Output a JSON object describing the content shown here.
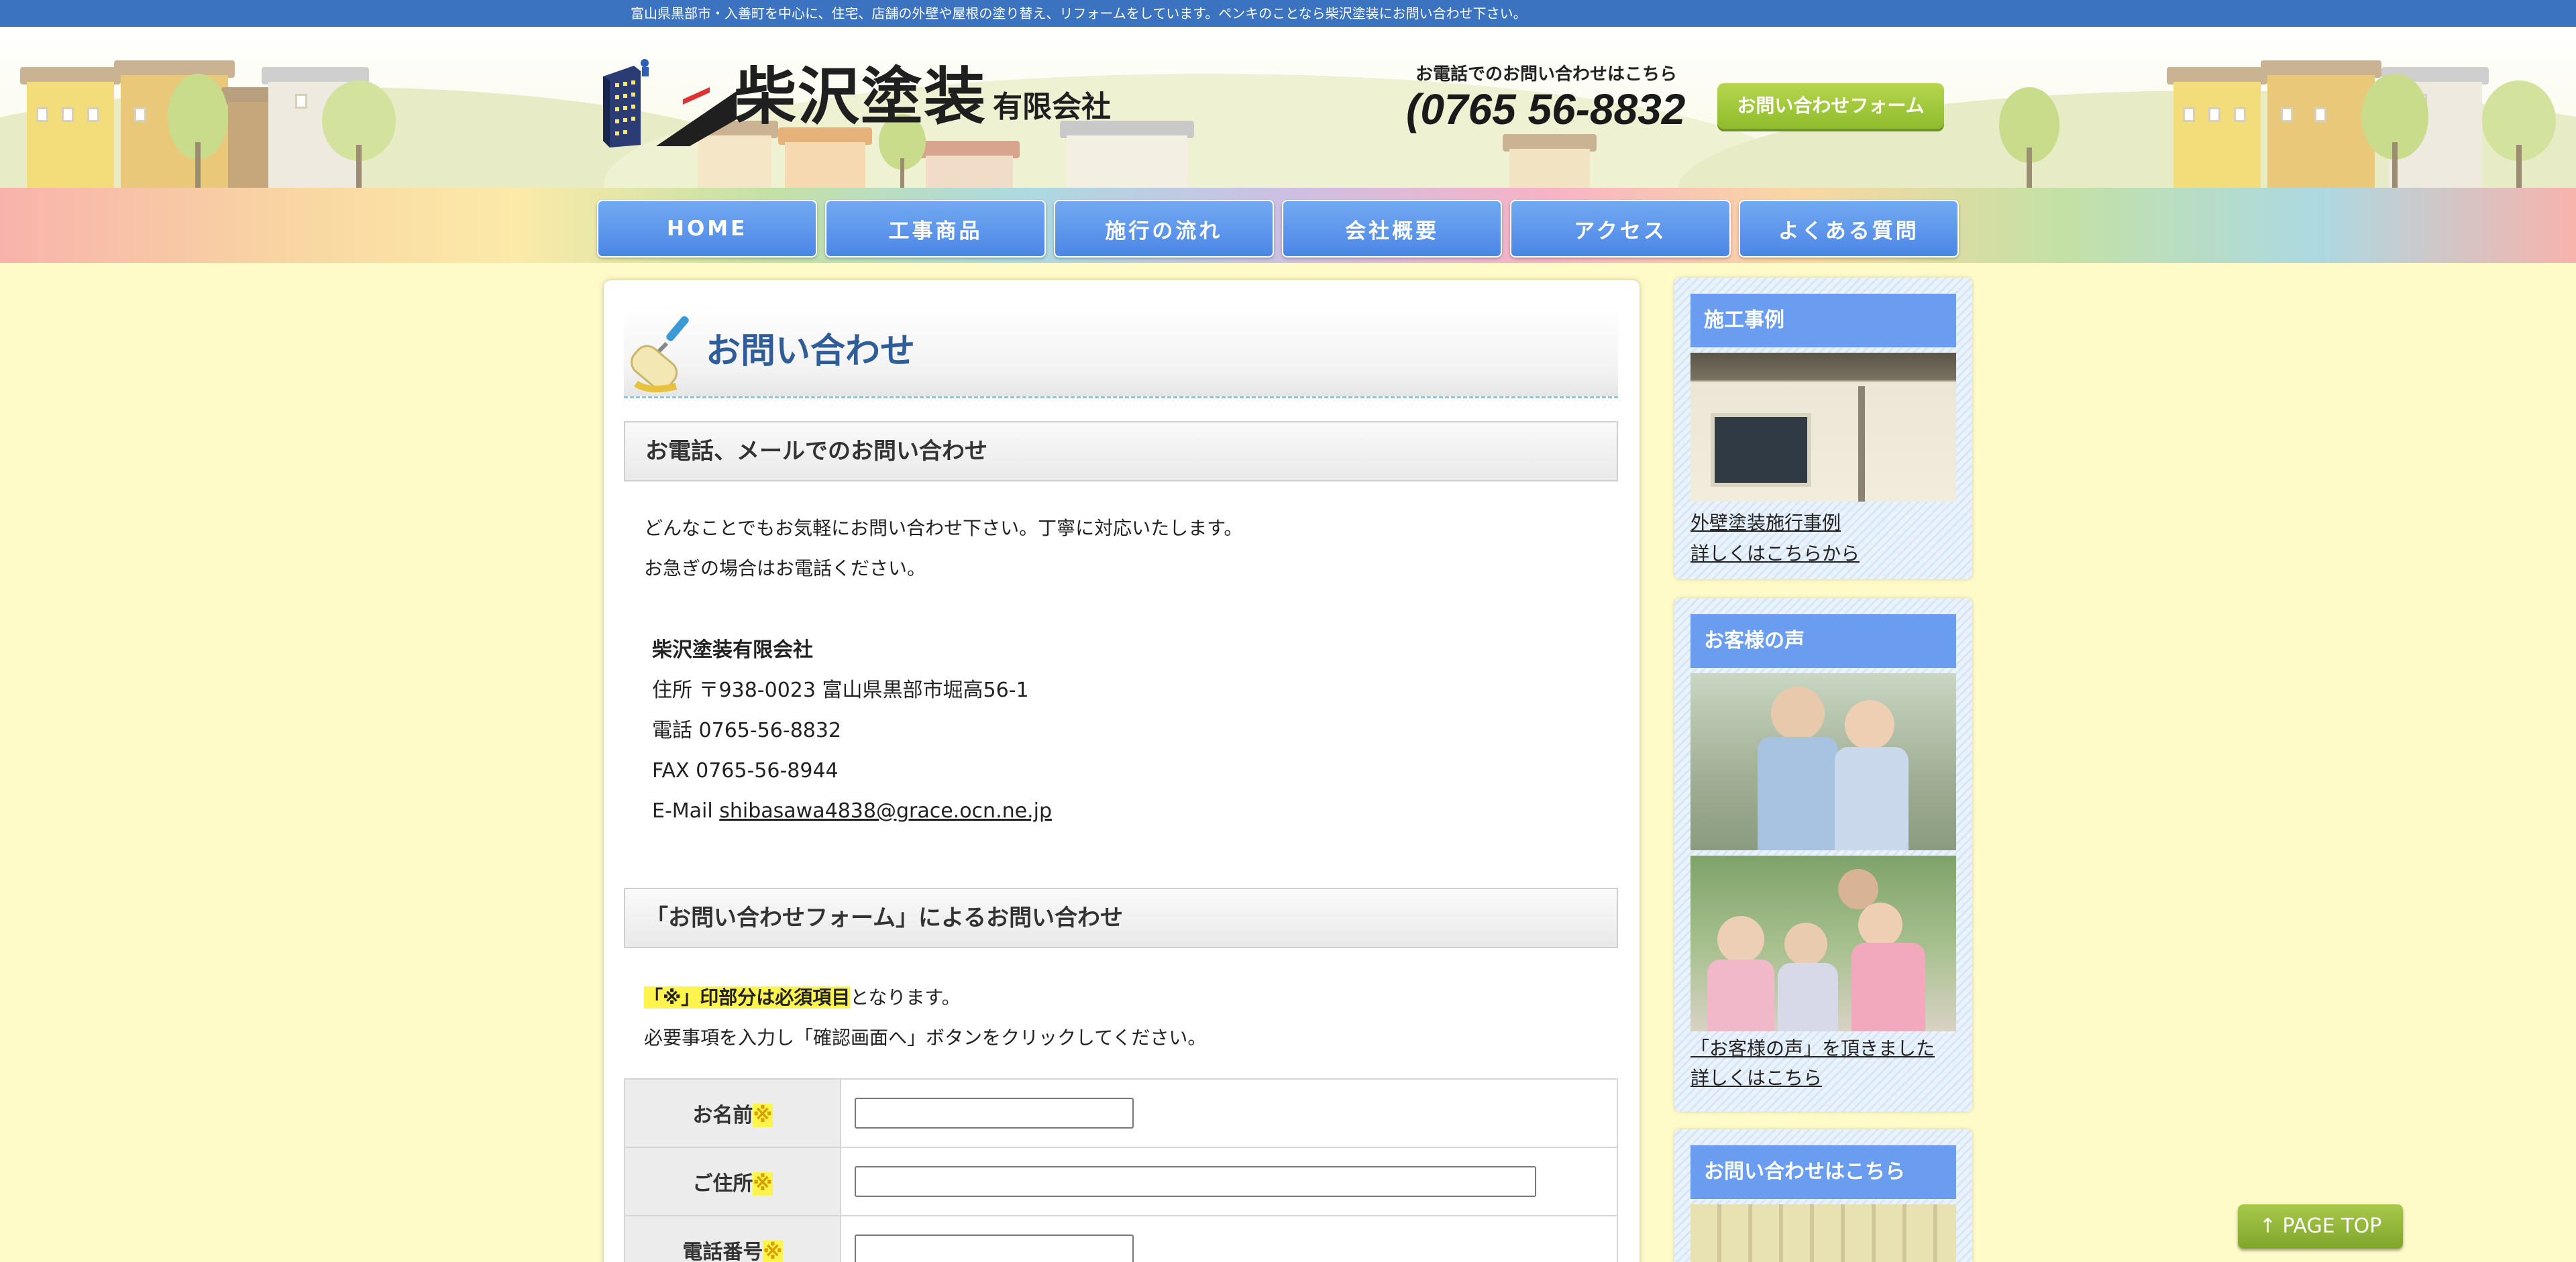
{
  "topbar": {
    "text": "富山県黒部市・入善町を中心に、住宅、店舗の外壁や屋根の塗り替え、リフォームをしています。ペンキのことなら柴沢塗装にお問い合わせ下さい。"
  },
  "header": {
    "logo_main": "柴沢塗装",
    "logo_sub": "有限会社",
    "tel_label": "お電話でのお問い合わせはこちら",
    "tel_number": "0765 56-8832",
    "inquiry_button": "お問い合わせフォーム"
  },
  "nav": {
    "items": [
      {
        "label": "HOME"
      },
      {
        "label": "工事商品"
      },
      {
        "label": "施行の流れ"
      },
      {
        "label": "会社概要"
      },
      {
        "label": "アクセス"
      },
      {
        "label": "よくある質問"
      }
    ]
  },
  "main": {
    "page_title": "お問い合わせ",
    "section1_title": "お電話、メールでのお問い合わせ",
    "intro_line1": "どんなことでもお気軽にお問い合わせ下さい。丁寧に対応いたします。",
    "intro_line2": "お急ぎの場合はお電話ください。",
    "company_name": "柴沢塗装有限会社",
    "address": "住所 〒938-0023 富山県黒部市堀高56-1",
    "phone": "電話 0765-56-8832",
    "fax": "FAX 0765-56-8944",
    "email_label": "E-Mail ",
    "email": "shibasawa4838@grace.ocn.ne.jp",
    "section2_title": "「お問い合わせフォーム」によるお問い合わせ",
    "required_note_highlight": "「※」印部分は必須項目",
    "required_note_rest": "となります。",
    "instruction": "必要事項を入力し「確認画面へ」ボタンをクリックしてください。",
    "form": {
      "required_mark": "※",
      "fields": [
        {
          "label": "お名前",
          "value": ""
        },
        {
          "label": "ご住所",
          "value": ""
        },
        {
          "label": "電話番号",
          "value": ""
        }
      ]
    }
  },
  "sidebar": {
    "works": {
      "title": "施工事例",
      "link_line1": "外壁塗装施行事例",
      "link_line2": "詳しくはこちらから"
    },
    "voice": {
      "title": "お客様の声",
      "link_text": "「お客様の声」を頂きました 詳しくはこちら"
    },
    "contact": {
      "title": "お問い合わせはこちら"
    }
  },
  "pagetop": {
    "label": "↑ PAGE TOP"
  },
  "colors": {
    "topbar": "#3b73c0",
    "nav_button": "#4b86e4",
    "accent_green": "#8fbb2c",
    "page_bg": "#fffbc9",
    "title_blue": "#2e5d99",
    "highlight": "#fff34d"
  }
}
